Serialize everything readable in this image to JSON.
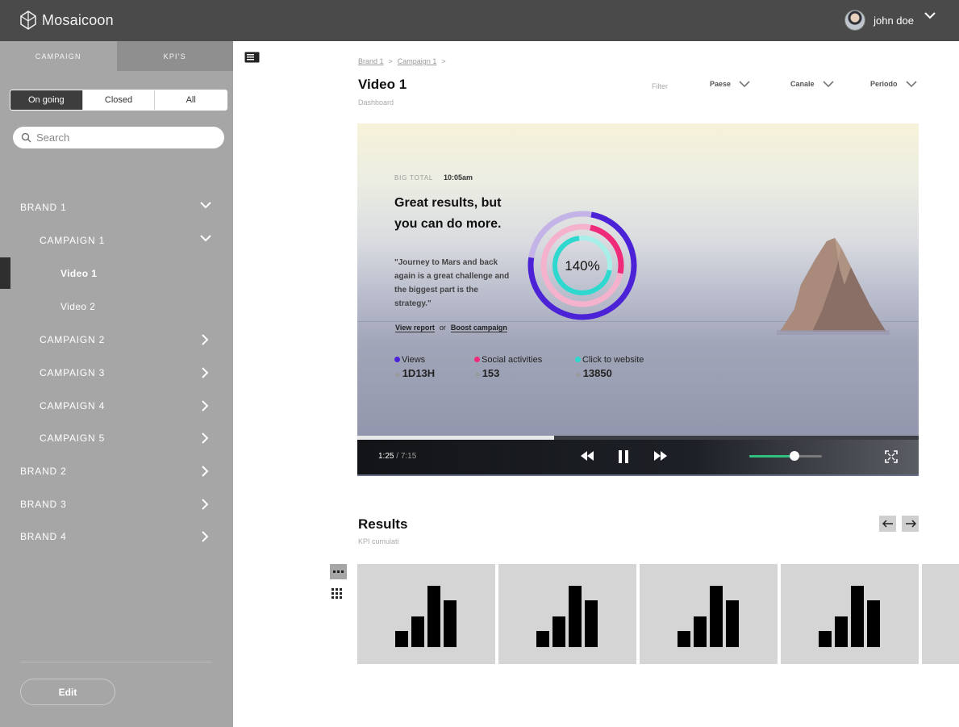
{
  "app": {
    "name": "Mosaicoon"
  },
  "user": {
    "name": "john doe"
  },
  "sidebar": {
    "tabs": [
      "CAMPAIGN",
      "KPI'S"
    ],
    "filters": [
      "On going",
      "Closed",
      "All"
    ],
    "search_placeholder": "Search",
    "tree": [
      {
        "label": "BRAND 1"
      },
      {
        "label": "CAMPAIGN 1"
      },
      {
        "label": "Video 1"
      },
      {
        "label": "Video 2"
      },
      {
        "label": "CAMPAIGN 2"
      },
      {
        "label": "CAMPAIGN 3"
      },
      {
        "label": "CAMPAIGN 4"
      },
      {
        "label": "CAMPAIGN 5"
      },
      {
        "label": "BRAND 2"
      },
      {
        "label": "BRAND 3"
      },
      {
        "label": "BRAND 4"
      }
    ],
    "edit_label": "Edit"
  },
  "header": {
    "breadcrumb": [
      "Brand 1",
      "Campaign 1"
    ],
    "breadcrumb_sep": ">",
    "title": "Video 1",
    "subtitle": "Dashboard",
    "filter_label": "Filter",
    "dropdowns": [
      "Paese",
      "Canale",
      "Periodo"
    ]
  },
  "video": {
    "big_total": "BIG TOTAL",
    "time": "10:05am",
    "headline": "Great results, but you can do more.",
    "quote": "\"Journey to Mars and back again is a great challenge and the biggest part is the strategy.\"",
    "link_report": "View report",
    "link_or": "or",
    "link_boost": "Boost campaign",
    "percent": "140%",
    "stats": [
      {
        "label": "Views",
        "value": "1D13H",
        "color": "#4b22d6"
      },
      {
        "label": "Social activities",
        "value": "153",
        "color": "#ef2a7a"
      },
      {
        "label": "Click to website",
        "value": "13850",
        "color": "#2fd8cf"
      }
    ]
  },
  "player": {
    "current": "1:25",
    "total": "7:15",
    "progress": 0.35,
    "volume": 0.62,
    "accent": "#2ec27e"
  },
  "results": {
    "title": "Results",
    "subtitle": "KPI cumulati"
  }
}
